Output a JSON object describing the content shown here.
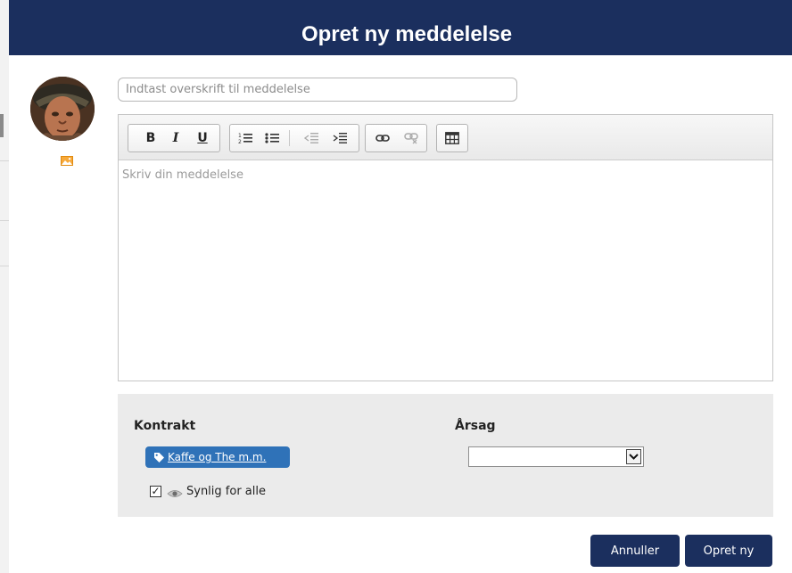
{
  "dialog": {
    "title": "Opret ny meddelelse"
  },
  "avatar": {
    "edit_icon": "image-icon"
  },
  "subject": {
    "placeholder": "Indtast overskrift til meddelelse",
    "value": ""
  },
  "editor": {
    "toolbar": {
      "bold": "B",
      "italic": "I",
      "underline": "U",
      "icons": [
        "bold-icon",
        "italic-icon",
        "underline-icon",
        "ordered-list-icon",
        "bullet-list-icon",
        "outdent-icon",
        "indent-icon",
        "link-icon",
        "unlink-icon",
        "table-icon"
      ]
    },
    "placeholder": "Skriv din meddelelse"
  },
  "details": {
    "contract_label": "Kontrakt",
    "contract_tag": "Kaffe og The m.m.",
    "visible_label": "Synlig for alle",
    "visible_checked": true,
    "reason_label": "Årsag",
    "reason_value": ""
  },
  "actions": {
    "cancel": "Annuller",
    "create": "Opret ny"
  },
  "colors": {
    "header": "#1b2f5e",
    "tag": "#2f72b8",
    "panel": "#ebebeb"
  }
}
